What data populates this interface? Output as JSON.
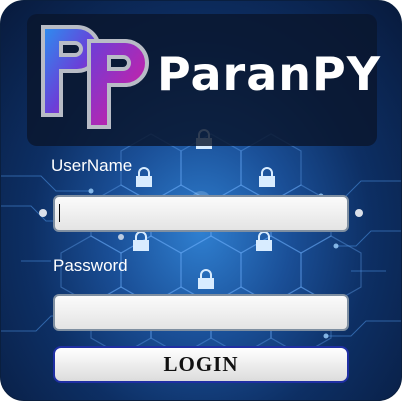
{
  "brand": {
    "name": "ParanPY",
    "logo_icon": "pp-logo-icon"
  },
  "form": {
    "username_label": "UserName",
    "username_value": "",
    "password_label": "Password",
    "password_value": "",
    "login_label": "LOGIN"
  },
  "background": {
    "pattern": "hexagon-circuit-lock-icons"
  },
  "colors": {
    "background_dark": "#081a3c",
    "background_glow": "#2f7fd0",
    "button_border": "#1f2fa3",
    "logo_pink": "#e0189a",
    "logo_purple": "#6a3fd8",
    "logo_blue": "#2b8ff0"
  }
}
